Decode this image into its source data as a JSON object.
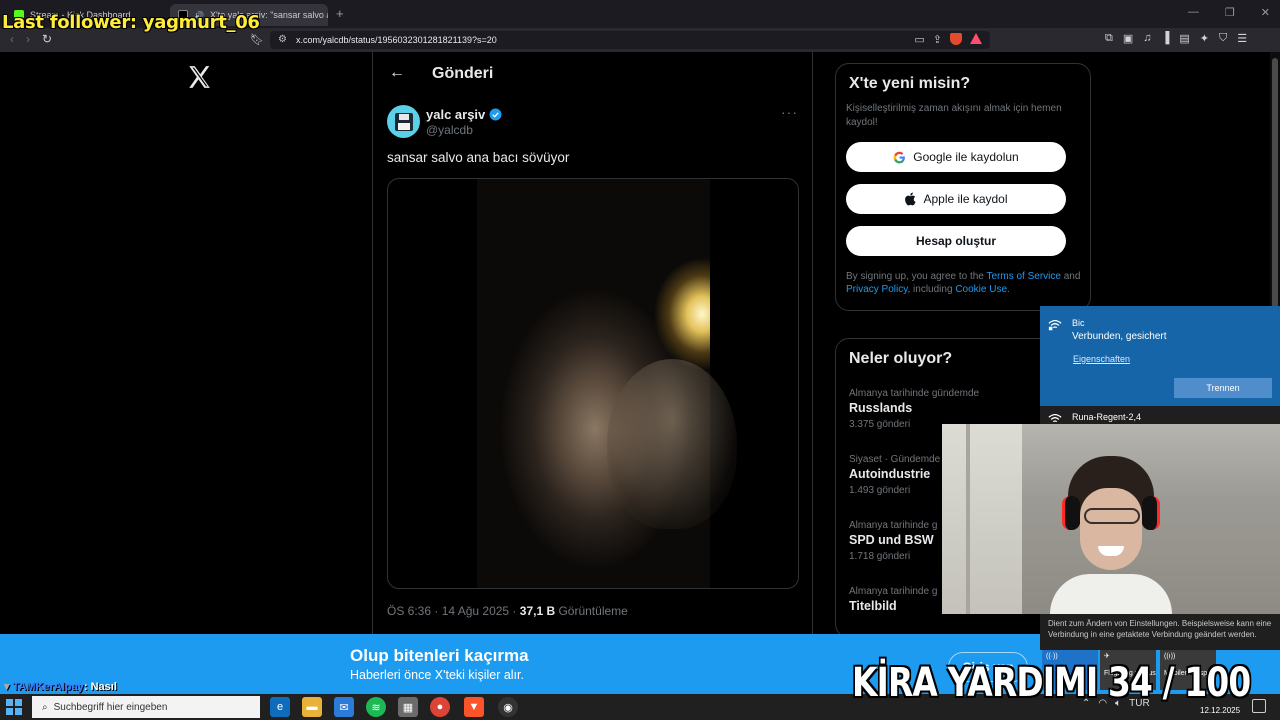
{
  "overlay": {
    "last_follower": "Last follower: yagmurt_06",
    "chat_user": "TAMKerAlpay",
    "chat_message": ": Nasıl",
    "rent_goal": "KİRA YARDIMI 34 / 100"
  },
  "browser": {
    "tabs": [
      {
        "label": "Stream - Kick Dashboard",
        "icon": "kick-icon",
        "active": false
      },
      {
        "label": "X'te yalc arşiv: \"sansar salvo a",
        "icon": "x-icon",
        "active": true
      }
    ],
    "url": "x.com/yalcdb/status/1956032301281821139?s=20"
  },
  "post": {
    "header_title": "Gönderi",
    "author_name": "yalc arşiv",
    "author_handle": "@yalcdb",
    "text": "sansar salvo ana bacı sövüyor",
    "time": "ÖS 6:36 · 14 Ağu 2025 · ",
    "views_count": "37,1 B",
    "views_label": " Görüntüleme"
  },
  "signup": {
    "title": "X'te yeni misin?",
    "subtitle": "Kişiselleştirilmiş zaman akışını almak için hemen kaydol!",
    "google_label": "Google ile kaydolun",
    "apple_label": "Apple ile kaydol",
    "create_label": "Hesap oluştur",
    "legal_1": "By signing up, you agree to the ",
    "legal_terms": "Terms of Service",
    "legal_2": " and ",
    "legal_privacy": "Privacy Policy",
    "legal_3": ", including ",
    "legal_cookie": "Cookie Use",
    "legal_4": "."
  },
  "trends": {
    "title": "Neler oluyor?",
    "items": [
      {
        "context": "Almanya tarihinde gündemde",
        "name": "Russlands",
        "count": "3.375 gönderi"
      },
      {
        "context": "Siyaset · Gündemde",
        "name": "Autoindustrie",
        "count": "1.493 gönderi"
      },
      {
        "context": "Almanya tarihinde g",
        "name": "SPD und BSW",
        "count": "1.718 gönderi"
      },
      {
        "context": "Almanya tarihinde g",
        "name": "Titelbild",
        "count": ""
      }
    ]
  },
  "wifi": {
    "network": "Bic",
    "status": "Verbunden, gesichert",
    "properties": "Eigenschaften",
    "disconnect": "Trennen",
    "other_network": "Runa-Regent-2,4",
    "note": "Dient zum Ändern von Einstellungen. Beispielsweise kann eine Verbindung in eine getaktete Verbindung geändert werden.",
    "tiles": [
      "",
      "Flugzeug modus",
      "Mobiler Hotsp"
    ]
  },
  "banner": {
    "title": "Olup bitenleri kaçırma",
    "subtitle": "Haberleri önce X'teki kişiler alır.",
    "login": "Giriş yap"
  },
  "taskbar": {
    "search_placeholder": "Suchbegriff hier eingeben",
    "lang": "TUR",
    "date": "12.12.2025"
  },
  "colors": {
    "x_blue": "#1d9bf0",
    "follower_yellow": "#ffeb3b",
    "wifi_blue": "#1565a8"
  }
}
